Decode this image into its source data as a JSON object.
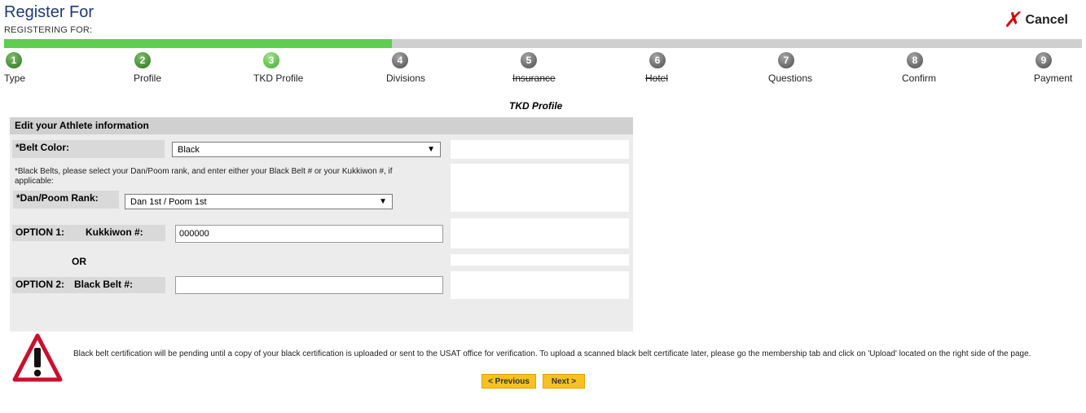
{
  "header": {
    "title": "Register For",
    "subtitle": "REGISTERING FOR:",
    "cancel_label": "Cancel"
  },
  "progress": {
    "fraction": 0.36
  },
  "steps": [
    {
      "num": "1",
      "label": "Type",
      "state": "done",
      "strike": false
    },
    {
      "num": "2",
      "label": "Profile",
      "state": "done",
      "strike": false
    },
    {
      "num": "3",
      "label": "TKD Profile",
      "state": "current",
      "strike": false
    },
    {
      "num": "4",
      "label": "Divisions",
      "state": "todo",
      "strike": false
    },
    {
      "num": "5",
      "label": "Insurance",
      "state": "todo",
      "strike": true
    },
    {
      "num": "6",
      "label": "Hotel",
      "state": "todo",
      "strike": true
    },
    {
      "num": "7",
      "label": "Questions",
      "state": "todo",
      "strike": false
    },
    {
      "num": "8",
      "label": "Confirm",
      "state": "todo",
      "strike": false
    },
    {
      "num": "9",
      "label": "Payment",
      "state": "todo",
      "strike": false
    }
  ],
  "form": {
    "section_title": "TKD Profile",
    "panel_title": "Edit your Athlete information",
    "belt_color_label": "*Belt Color:",
    "belt_color_value": "Black",
    "black_belt_note": "*Black Belts, please select your Dan/Poom rank, and enter either your Black Belt # or your Kukkiwon #, if applicable:",
    "dan_label": "*Dan/Poom Rank:",
    "dan_value": "Dan 1st / Poom 1st",
    "option1_label": "OPTION 1:",
    "kukkiwon_label": "Kukkiwon #:",
    "kukkiwon_value": "000000",
    "or_text": "OR",
    "option2_label": "OPTION 2:",
    "black_belt_label": "Black Belt #:",
    "black_belt_value": ""
  },
  "warning": {
    "text": "Black belt certification will be pending until a copy of your black certification is uploaded or sent to the USAT office for verification. To upload a scanned black belt certificate later, please go the membership tab and click on 'Upload' located on the right side of the page."
  },
  "buttons": {
    "previous": "< Previous",
    "next": "Next >"
  },
  "colors": {
    "progress_green": "#5dce4e",
    "title_blue": "#1f3a6e",
    "cancel_red": "#d40000",
    "button_yellow": "#f6c220"
  }
}
